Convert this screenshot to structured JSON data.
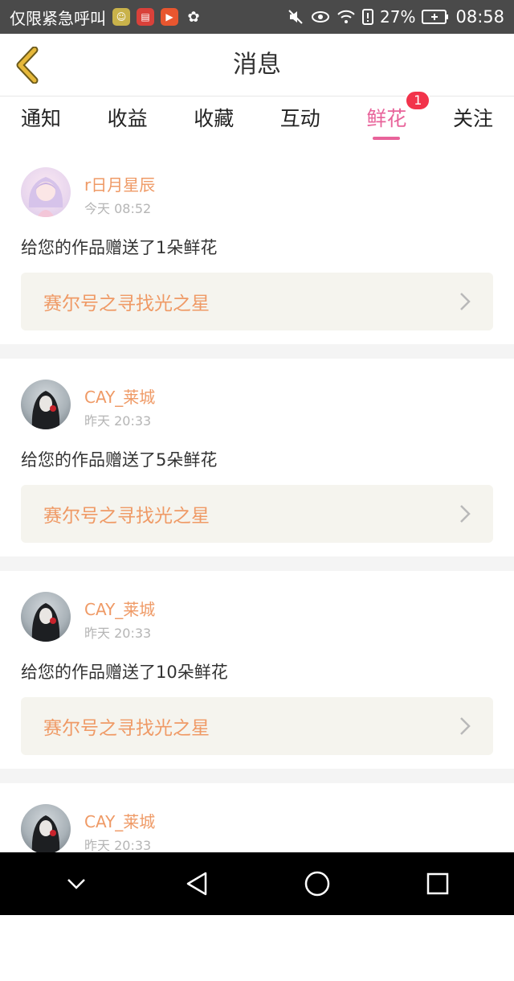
{
  "statusbar": {
    "carrier_text": "仅限紧急呼叫",
    "app_icons": [
      "emoticon-icon",
      "news-icon",
      "video-icon",
      "wechat-icon"
    ],
    "battery": "27%",
    "time": "08:58"
  },
  "header": {
    "title": "消息"
  },
  "tabs": [
    {
      "label": "通知"
    },
    {
      "label": "收益"
    },
    {
      "label": "收藏"
    },
    {
      "label": "互动"
    },
    {
      "label": "鲜花",
      "badge": "1",
      "active": true
    },
    {
      "label": "关注"
    }
  ],
  "messages": [
    {
      "user": "r日月星辰",
      "time": "今天 08:52",
      "text": "给您的作品赠送了1朵鲜花",
      "work": "赛尔号之寻找光之星"
    },
    {
      "user": "CAY_莱城",
      "time": "昨天 20:33",
      "text": "给您的作品赠送了5朵鲜花",
      "work": "赛尔号之寻找光之星"
    },
    {
      "user": "CAY_莱城",
      "time": "昨天 20:33",
      "text": "给您的作品赠送了10朵鲜花",
      "work": "赛尔号之寻找光之星"
    },
    {
      "user": "CAY_莱城",
      "time": "昨天 20:33"
    }
  ],
  "colors": {
    "accent_pink": "#e8639a",
    "username_orange": "#ef9a66",
    "badge_red": "#f2334b",
    "back_chevron": "#e6b83a"
  }
}
